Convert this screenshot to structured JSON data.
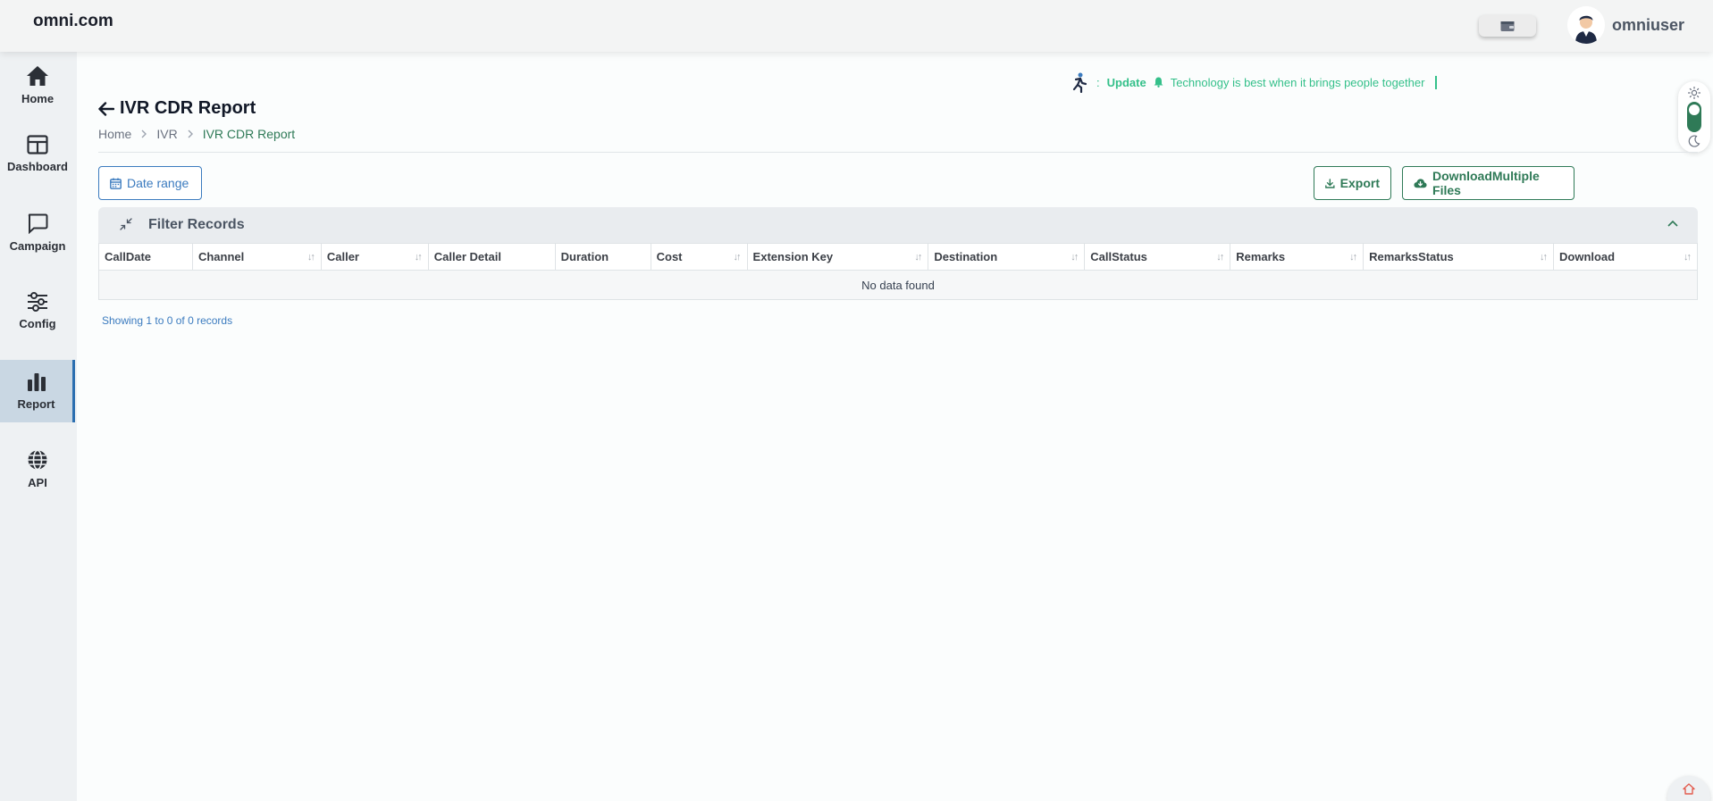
{
  "brand": "omni.com",
  "user": {
    "name": "omniuser"
  },
  "sidebar": {
    "items": [
      {
        "label": "Home",
        "icon": "home-icon"
      },
      {
        "label": "Dashboard",
        "icon": "dashboard-icon"
      },
      {
        "label": "Campaign",
        "icon": "chat-icon"
      },
      {
        "label": "Config",
        "icon": "sliders-icon"
      },
      {
        "label": "Report",
        "icon": "bar-chart-icon",
        "active": true
      },
      {
        "label": "API",
        "icon": "globe-icon"
      }
    ]
  },
  "ticker": {
    "prefix": ":",
    "tag": "Update",
    "message": "Technology is best when it brings people together"
  },
  "page": {
    "title": "IVR CDR Report"
  },
  "breadcrumb": [
    "Home",
    "IVR",
    "IVR CDR Report"
  ],
  "toolbar": {
    "date_range": "Date range",
    "export": "Export",
    "download_multiple": "DownloadMultiple Files"
  },
  "filter": {
    "label": "Filter Records"
  },
  "table": {
    "columns": [
      "CallDate",
      "Channel",
      "Caller",
      "Caller Detail",
      "Duration",
      "Cost",
      "Extension Key",
      "Destination",
      "CallStatus",
      "Remarks",
      "RemarksStatus",
      "Download"
    ],
    "empty": "No data found"
  },
  "pagination": {
    "summary": "Showing 1 to 0 of 0 records"
  },
  "colors": {
    "accent_green": "#2f7a57",
    "accent_blue": "#3b7bbf",
    "ticker_green": "#34c08a",
    "sidebar_active": "#c9d7e3"
  }
}
